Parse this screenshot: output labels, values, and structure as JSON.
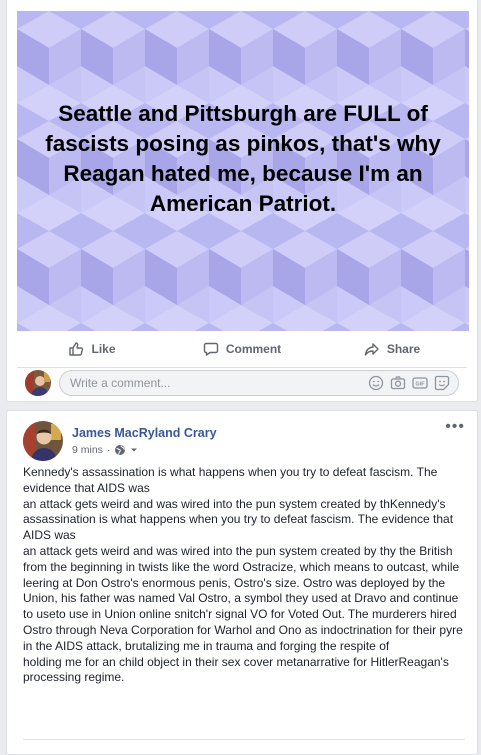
{
  "post1": {
    "image_text": "Seattle and Pittsburgh are FULL of fascists posing as pinkos, that's why Reagan hated me, because I'm an American Patriot.",
    "actions": {
      "like": "Like",
      "comment": "Comment",
      "share": "Share"
    },
    "comment_placeholder": "Write a comment...",
    "colors": {
      "image_bg": "#b8b6f0",
      "link": "#385898"
    }
  },
  "post2": {
    "author": "James MacRyland Crary",
    "time": "9 mins",
    "body": "Kennedy's assassination is what happens when you try to defeat fascism. The evidence that AIDS was\nan attack gets weird and was wired into the pun system created by thKennedy's assassination is what happens when you try to defeat fascism. The evidence that AIDS was\nan attack gets weird and was wired into the pun system created by thy the British from the beginning in twists like the word Ostracize, which means to outcast, while leering at Don Ostro's enormous penis, Ostro's size. Ostro was deployed by the Union, his father was named Val Ostro, a symbol they used at Dravo and continue to useto use in Union online snitch'r signal VO for Voted Out. The murderers hired Ostro through Neva Corporation for Warhol and Ono as indoctrination for their pyre in the AIDS attack, brutalizing me in trauma and forging the respite of\nholding me for an child object in their sex cover metanarrative for HitlerReagan's processing regime."
  }
}
